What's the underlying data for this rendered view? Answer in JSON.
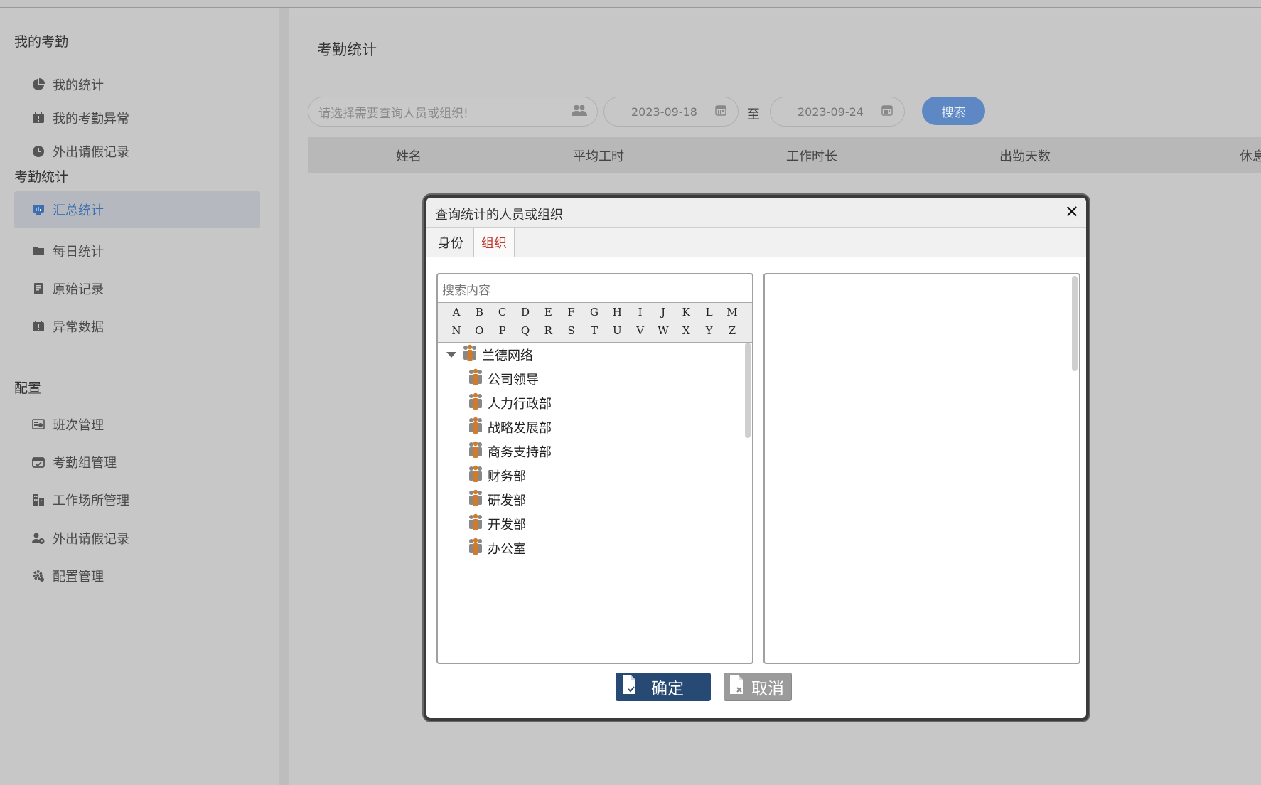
{
  "sidebar": {
    "groups": [
      {
        "title": "我的考勤"
      },
      {
        "title": "考勤统计"
      },
      {
        "title": "配置"
      }
    ],
    "items": [
      {
        "label": "我的统计",
        "icon": "pie-chart-icon"
      },
      {
        "label": "我的考勤异常",
        "icon": "calendar-alert-icon"
      },
      {
        "label": "外出请假记录",
        "icon": "clock-icon"
      },
      {
        "label": "汇总统计",
        "icon": "monitor-chart-icon"
      },
      {
        "label": "每日统计",
        "icon": "folder-icon"
      },
      {
        "label": "原始记录",
        "icon": "document-icon"
      },
      {
        "label": "异常数据",
        "icon": "calendar-alert-icon"
      },
      {
        "label": "班次管理",
        "icon": "schedule-icon"
      },
      {
        "label": "考勤组管理",
        "icon": "calendar-check-icon"
      },
      {
        "label": "工作场所管理",
        "icon": "building-icon"
      },
      {
        "label": "外出请假记录",
        "icon": "user-clock-icon"
      },
      {
        "label": "配置管理",
        "icon": "gear-icon"
      }
    ]
  },
  "main": {
    "title": "考勤统计",
    "search_placeholder": "请选择需要查询人员或组织!",
    "date_from": "2023-09-18",
    "date_to": "2023-09-24",
    "to_label": "至",
    "search_button": "搜索",
    "columns": [
      "姓名",
      "平均工时",
      "工作时长",
      "出勤天数",
      "休息"
    ]
  },
  "dialog": {
    "title": "查询统计的人员或组织",
    "close": "✕",
    "tabs": [
      "身份",
      "组织"
    ],
    "search_placeholder": "搜索内容",
    "alpha_row1": [
      "A",
      "B",
      "C",
      "D",
      "E",
      "F",
      "G",
      "H",
      "I",
      "J",
      "K",
      "L",
      "M"
    ],
    "alpha_row2": [
      "N",
      "O",
      "P",
      "Q",
      "R",
      "S",
      "T",
      "U",
      "V",
      "W",
      "X",
      "Y",
      "Z"
    ],
    "root": "兰德网络",
    "children": [
      "公司领导",
      "人力行政部",
      "战略发展部",
      "商务支持部",
      "财务部",
      "研发部",
      "开发部",
      "办公室"
    ],
    "ok_button": "确定",
    "cancel_button": "取消"
  },
  "colors": {
    "accent": "#5e88c4",
    "active_tab": "#c0392b",
    "ok_button": "#264a73",
    "tree_icon": "#d07a2c"
  }
}
